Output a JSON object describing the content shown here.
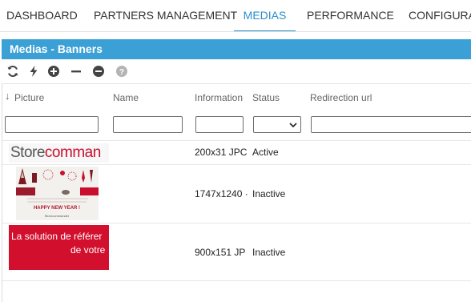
{
  "nav": {
    "tabs": [
      {
        "label": "DASHBOARD"
      },
      {
        "label": "PARTNERS MANAGEMENT"
      },
      {
        "label": "MEDIAS"
      },
      {
        "label": "PERFORMANCE"
      },
      {
        "label": "CONFIGURATI"
      }
    ],
    "active_index": 2,
    "accent_color": "#2a8ec9"
  },
  "panel": {
    "title": "Medias - Banners",
    "header_color": "#3ba0d5"
  },
  "toolbar": {
    "icons": [
      "refresh-icon",
      "lightning-icon",
      "add-circle-icon",
      "minus-icon",
      "remove-circle-icon",
      "help-icon"
    ]
  },
  "grid": {
    "columns": [
      "Picture",
      "Name",
      "Information",
      "Status",
      "Redirection url"
    ],
    "sort_indicator": "↓",
    "rows": [
      {
        "picture_text": "Storecomman",
        "name": "",
        "information": "200x31 JPC",
        "status": "Active",
        "redirection_url": ""
      },
      {
        "picture_text": "HAPPY NEW YEAR !",
        "picture_caption": "Storecommander",
        "name": "",
        "information": "1747x1240 ·",
        "status": "Inactive",
        "redirection_url": ""
      },
      {
        "picture_text_line1": "La solution de référer",
        "picture_text_line2": "de votre",
        "name": "",
        "information": "900x151 JP",
        "status": "Inactive",
        "redirection_url": ""
      }
    ]
  }
}
